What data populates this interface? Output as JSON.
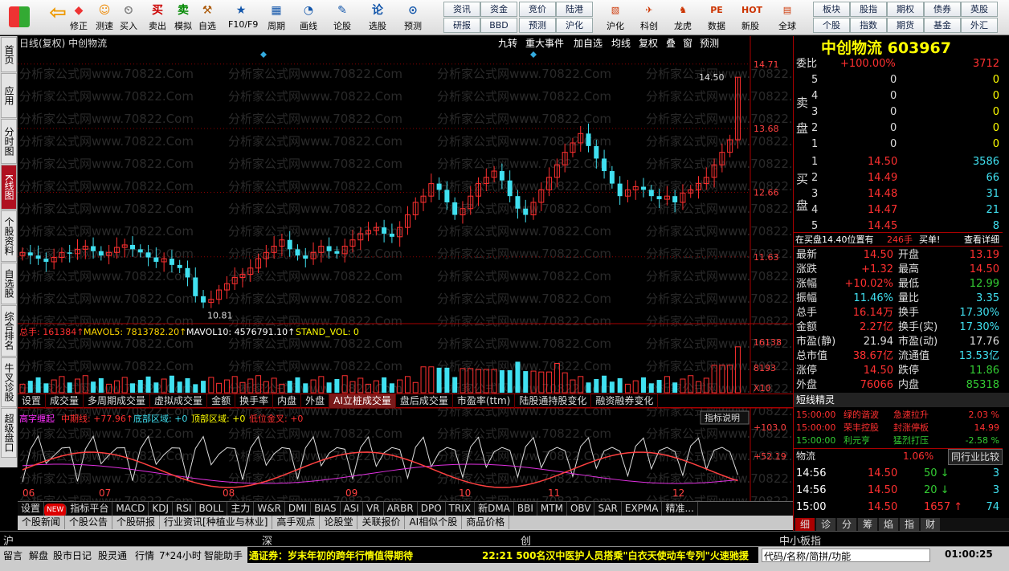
{
  "toolbar": {
    "buttons": [
      "修正",
      "测速",
      "买入",
      "卖出",
      "模拟",
      "自选",
      "F10/F9",
      "周期",
      "画线",
      "论股",
      "选股",
      "预测",
      "沪化",
      "科创",
      "龙虎",
      "数据",
      "新股",
      "全球"
    ],
    "right_buttons": [
      "资讯",
      "资金",
      "竞价",
      "陆港",
      "研报",
      "BBD",
      "预测",
      "沪化",
      "板块",
      "股指",
      "期权",
      "债券",
      "英股",
      "个股",
      "指数",
      "期货",
      "基金",
      "外汇"
    ]
  },
  "leftnav": [
    "首页",
    "应用",
    "分时图",
    "K线图",
    "个股资料",
    "自选股",
    "综合排名",
    "牛叉诊股",
    "超级盘口"
  ],
  "chart": {
    "header_left": "日线(复权)  中创物流",
    "header_buttons": [
      "九转",
      "重大事件",
      "加自选",
      "均线",
      "复权",
      "叠",
      "窗",
      "预测"
    ],
    "watermark": "分析家公式网www.70822.Com",
    "price_labels": [
      "14.71",
      "13.68",
      "12.66",
      "11.63"
    ],
    "high_label": "14.50",
    "low_label": "10.81",
    "vol_title": "总手: 161384↑",
    "vol_ma5": "MAVOL5: 7813782.20↑",
    "vol_ma10": "MAVOL10: 4576791.10↑",
    "vol_stand": "STAND_VOL: 0",
    "vol_labels": [
      "16138",
      "8193",
      "X10"
    ],
    "ind_title": "高字缠起",
    "ind_mid": "中期线: +77.96↑",
    "ind_bottom": "底部区域: +0",
    "ind_top": "顶部区域: +0",
    "ind_low": "低位金叉: +0",
    "ind_btn": "指标说明",
    "ind_labels": [
      "+103.0",
      "+52.19"
    ],
    "months": [
      "06",
      "07",
      "08",
      "09",
      "10",
      "11",
      "12"
    ]
  },
  "chart_data": {
    "type": "candlestick",
    "title": "日线(复权) 中创物流",
    "ylim": [
      10.6,
      14.9
    ],
    "high": 14.5,
    "low": 10.81,
    "closes": [
      11.7,
      11.65,
      11.6,
      11.55,
      11.62,
      11.7,
      11.68,
      11.75,
      11.8,
      11.72,
      11.65,
      11.7,
      11.78,
      11.82,
      11.75,
      11.7,
      11.62,
      11.55,
      11.6,
      11.5,
      11.45,
      11.3,
      11.0,
      10.9,
      10.95,
      11.1,
      11.2,
      11.3,
      11.35,
      11.45,
      11.6,
      11.7,
      11.8,
      11.9,
      11.75,
      11.65,
      11.6,
      11.7,
      11.8,
      11.72,
      11.68,
      11.8,
      11.9,
      12.0,
      12.05,
      12.1,
      12.0,
      11.95,
      12.1,
      12.3,
      12.5,
      12.6,
      12.8,
      12.7,
      12.5,
      12.3,
      12.4,
      12.6,
      12.8,
      12.9,
      13.0,
      12.85,
      12.6,
      12.4,
      12.3,
      12.5,
      12.7,
      12.9,
      13.1,
      13.3,
      13.45,
      13.6,
      13.4,
      13.2,
      13.0,
      12.8,
      12.6,
      12.7,
      12.75,
      12.7,
      12.6,
      12.55,
      12.6,
      12.5,
      12.65,
      12.7,
      12.8,
      12.9,
      13.1,
      13.3,
      13.5,
      14.5
    ],
    "vol_labels": [
      16138,
      8193
    ],
    "indicator_labels": [
      103.0,
      52.19
    ]
  },
  "btabs1": [
    "设置",
    "成交量",
    "多周期成交量",
    "虚拟成交量",
    "金额",
    "换手率",
    "内盘",
    "外盘",
    "AI立桩成交量",
    "盘后成交量",
    "市盈率(ttm)",
    "陆股通持股变化",
    "融资融券变化"
  ],
  "indbar": [
    "设置",
    "NEW",
    "指标平台",
    "MACD",
    "KDJ",
    "RSI",
    "BOLL",
    "主力",
    "W&R",
    "DMI",
    "BIAS",
    "ASI",
    "VR",
    "ARBR",
    "DPO",
    "TRIX",
    "新DMA",
    "BBI",
    "MTM",
    "OBV",
    "SAR",
    "EXPMA",
    "精准..."
  ],
  "newsbar": [
    "个股新闻",
    "个股公告",
    "个股研报",
    "行业资讯[种植业与林业]",
    "高手观点",
    "论股堂",
    "关联报价",
    "AI相似个股",
    "商品价格"
  ],
  "mkt": {
    "sh": "沪",
    "sz": "深",
    "cy": "创",
    "zx": "中小板指"
  },
  "right": {
    "name": "中创物流",
    "code": "603967",
    "weibi_label": "委比",
    "weibi": "+100.00%",
    "weicha": "3712",
    "sell_label": "卖",
    "buy_label": "买",
    "pan": "盘",
    "sells": [
      {
        "n": "5",
        "p": "0",
        "v": "0"
      },
      {
        "n": "4",
        "p": "0",
        "v": "0"
      },
      {
        "n": "3",
        "p": "0",
        "v": "0"
      },
      {
        "n": "2",
        "p": "0",
        "v": "0"
      },
      {
        "n": "1",
        "p": "0",
        "v": "0"
      }
    ],
    "buys": [
      {
        "n": "1",
        "p": "14.50",
        "v": "3586"
      },
      {
        "n": "2",
        "p": "14.49",
        "v": "66"
      },
      {
        "n": "3",
        "p": "14.48",
        "v": "31"
      },
      {
        "n": "4",
        "p": "14.47",
        "v": "21"
      },
      {
        "n": "5",
        "p": "14.45",
        "v": "8"
      }
    ],
    "note": "在买盘14.40位置有",
    "note_vol": "246手",
    "note_act": "买单!",
    "note_detail": "查看详细",
    "stats": [
      [
        "最新",
        "14.50",
        "开盘",
        "13.19"
      ],
      [
        "涨跌",
        "+1.32",
        "最高",
        "14.50"
      ],
      [
        "涨幅",
        "+10.02%",
        "最低",
        "12.99"
      ],
      [
        "振幅",
        "11.46%",
        "量比",
        "3.35"
      ],
      [
        "总手",
        "16.14万",
        "换手",
        "17.30%"
      ],
      [
        "金额",
        "2.27亿",
        "换手(实)",
        "17.30%"
      ],
      [
        "市盈(静)",
        "21.94",
        "市盈(动)",
        "17.76"
      ],
      [
        "总市值",
        "38.67亿",
        "流通值",
        "13.53亿"
      ],
      [
        "涨停",
        "14.50",
        "跌停",
        "11.86"
      ],
      [
        "外盘",
        "76066",
        "内盘",
        "85318"
      ]
    ],
    "dx_title": "短线精灵",
    "dx": [
      [
        "15:00:00",
        "绿的谐波",
        "急速拉升",
        "2.03 %"
      ],
      [
        "15:00:00",
        "荣丰控股",
        "封涨停板",
        "14.99"
      ],
      [
        "15:00:00",
        "利元亨",
        "猛烈打压",
        "-2.58 %"
      ]
    ],
    "wl_label": "物流",
    "wl_val": "1.06%",
    "wl_btn": "同行业比较",
    "ticks": [
      [
        "14:56",
        "14.50",
        "50",
        "3"
      ],
      [
        "14:56",
        "14.50",
        "20",
        "3"
      ],
      [
        "15:00",
        "14.50",
        "1657",
        "74"
      ]
    ],
    "tabs": [
      "细",
      "诊",
      "分",
      "筹",
      "焰",
      "指",
      "财"
    ]
  },
  "status": {
    "items": [
      "留言",
      "解盘",
      "股市日记",
      "股灵通",
      "行情",
      "7*24小时",
      "智能助手"
    ],
    "news1": "通证券：岁末年初的跨年行情值得期待",
    "news2": "22:21 500名汉中医护人员搭乘\"白衣天使动车专列\"火速驰援",
    "search": "代码/名称/简拼/功能",
    "time": "01:00:25"
  },
  "colors": {
    "up": "#ff3030",
    "down": "#40e0f0",
    "label": "#ff3c3c",
    "yellow": "#ffff00",
    "bg": "#000000"
  }
}
